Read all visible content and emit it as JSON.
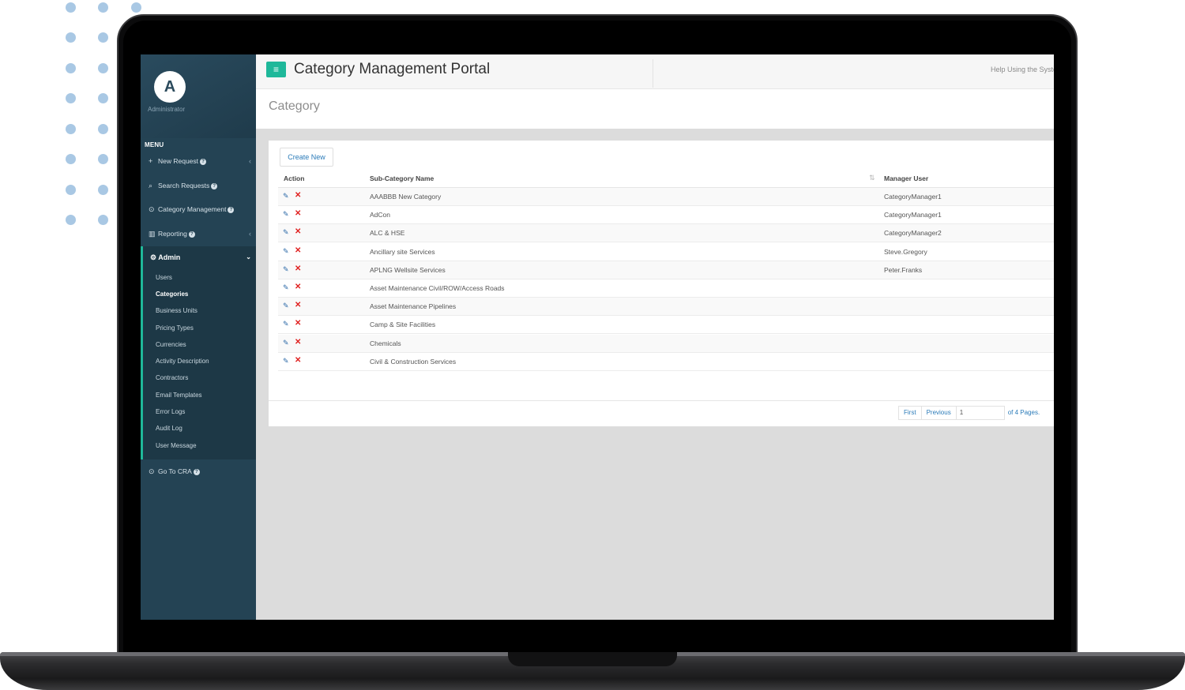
{
  "app": {
    "title": "Category Management Portal",
    "help_link": "Help Using the System",
    "menu_icon": "≡"
  },
  "user": {
    "initial": "A",
    "name": "Administrator"
  },
  "sidebar": {
    "menu_label": "MENU",
    "items": [
      {
        "label": "New Request",
        "icon": "plus-icon"
      },
      {
        "label": "Search Requests",
        "icon": "search-icon"
      },
      {
        "label": "Category Management",
        "icon": "circle-arrow-icon"
      },
      {
        "label": "Reporting",
        "icon": "bar-chart-icon"
      }
    ],
    "admin": {
      "label": "Admin",
      "icon": "gears-icon",
      "subitems": [
        "Users",
        "Categories",
        "Business Units",
        "Pricing Types",
        "Currencies",
        "Activity Description",
        "Contractors",
        "Email Templates",
        "Error Logs",
        "Audit Log",
        "User Message"
      ],
      "active_index": 1
    },
    "go_to_cra": "Go To CRA"
  },
  "page": {
    "title": "Category",
    "create_button": "Create New"
  },
  "table": {
    "columns": [
      "Action",
      "Sub-Category Name",
      "Manager User"
    ],
    "rows": [
      {
        "name": "AAABBB New Category",
        "manager": "CategoryManager1"
      },
      {
        "name": "AdCon",
        "manager": "CategoryManager1"
      },
      {
        "name": "ALC & HSE",
        "manager": "CategoryManager2"
      },
      {
        "name": "Ancillary site Services",
        "manager": "Steve.Gregory"
      },
      {
        "name": "APLNG Wellsite Services",
        "manager": "Peter.Franks"
      },
      {
        "name": "Asset Maintenance Civil/ROW/Access Roads",
        "manager": ""
      },
      {
        "name": "Asset Maintenance Pipelines",
        "manager": ""
      },
      {
        "name": "Camp & Site Facilities",
        "manager": ""
      },
      {
        "name": "Chemicals",
        "manager": ""
      },
      {
        "name": "Civil & Construction Services",
        "manager": ""
      }
    ]
  },
  "pagination": {
    "first": "First",
    "previous": "Previous",
    "current_page": "1",
    "of_pages": "of 4 Pages."
  },
  "colors": {
    "accent": "#1fb89a",
    "sidebar": "#244354",
    "edit": "#2d6aa8",
    "delete": "#e0201f"
  }
}
